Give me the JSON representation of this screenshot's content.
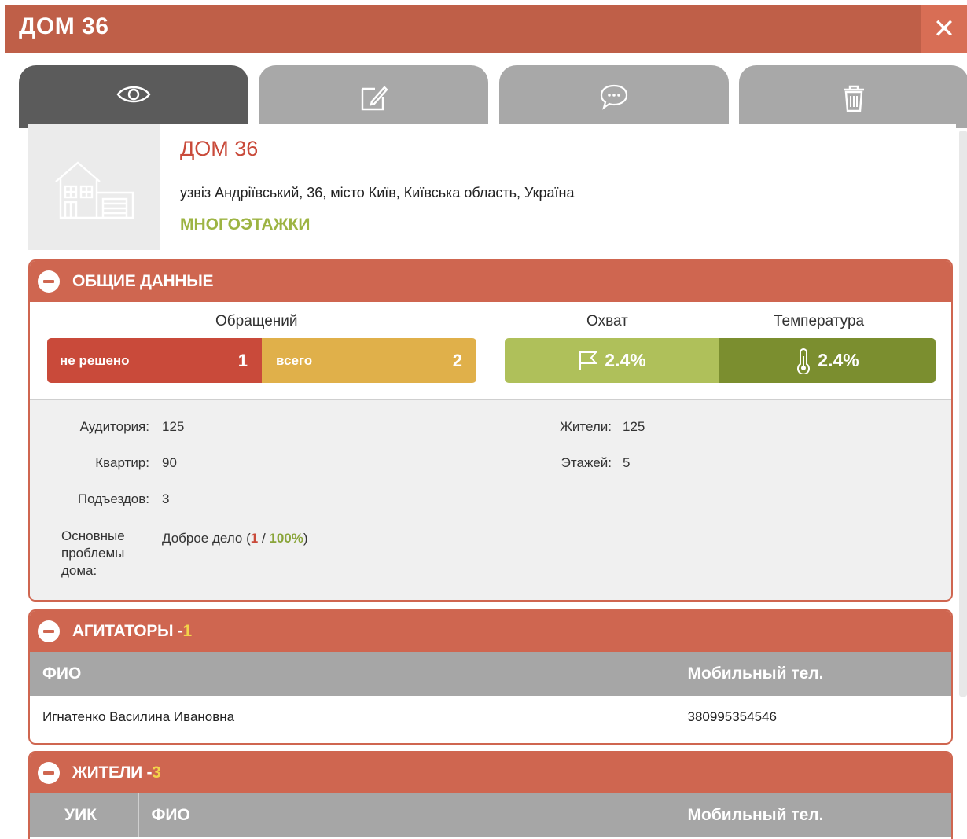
{
  "window": {
    "title": "ДОМ 36",
    "close_glyph": "✕"
  },
  "tabs": [
    {
      "icon": "eye-icon",
      "active": true
    },
    {
      "icon": "edit-icon",
      "active": false
    },
    {
      "icon": "chat-icon",
      "active": false
    },
    {
      "icon": "trash-icon",
      "active": false
    }
  ],
  "house": {
    "title": "ДОМ 36",
    "address": "узвіз Андріївський, 36, місто Київ, Київська область, Україна",
    "category": "МНОГОЭТАЖКИ",
    "photo_icon": "building-icon"
  },
  "general": {
    "header": "ОБЩИЕ ДАННЫЕ",
    "requests_caption": "Обращений",
    "coverage_caption": "Охват",
    "temperature_caption": "Температура",
    "unsolved_label": "не решено",
    "unsolved_value": "1",
    "total_label": "всего",
    "total_value": "2",
    "coverage_value": "2.4%",
    "temperature_value": "2.4%",
    "colors": {
      "unsolved": "#c94a3a",
      "total": "#e0b04a",
      "coverage": "#afc05a",
      "temperature": "#7b8e2f"
    },
    "audience_label": "Аудитория:",
    "audience_value": "125",
    "flats_label": "Квартир:",
    "flats_value": "90",
    "entrances_label": "Подъездов:",
    "entrances_value": "3",
    "problems_label": "Основные проблемы дома:",
    "problems_text": "Доброе дело (",
    "problems_count": "1",
    "problems_sep": " / ",
    "problems_pct": "100%",
    "problems_close": ")",
    "residents_label": "Жители:",
    "residents_value": "125",
    "floors_label": "Этажей:",
    "floors_value": "5"
  },
  "agitators": {
    "header": "АГИТАТОРЫ - ",
    "count": "1",
    "col_name": "ФИО",
    "col_phone": "Мобильный тел.",
    "rows": [
      {
        "name": "Игнатенко Василина Ивановна",
        "phone": "380995354546"
      }
    ]
  },
  "residents": {
    "header": "ЖИТЕЛИ - ",
    "count": "3",
    "col_uik": "УИК",
    "col_name": "ФИО",
    "col_phone": "Мобильный тел."
  }
}
